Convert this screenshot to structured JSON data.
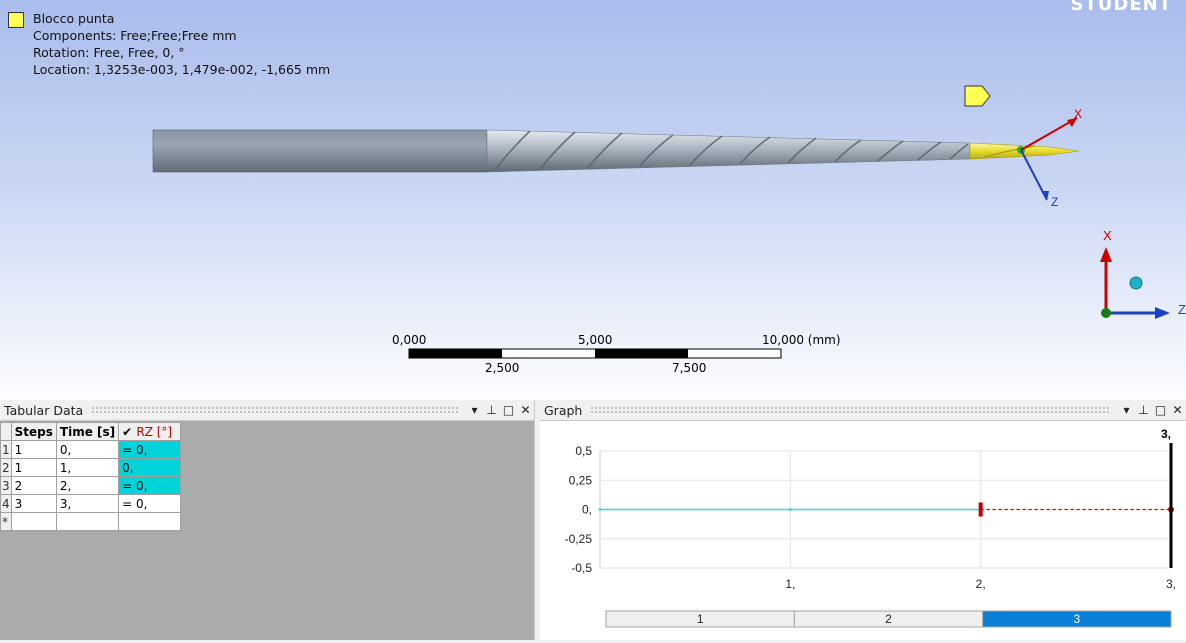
{
  "viewport": {
    "watermark": "STUDENT",
    "annotation": {
      "title": "Blocco punta",
      "components": "Components: Free;Free;Free mm",
      "rotation": "Rotation: Free, Free, 0, °",
      "location": "Location: 1,3253e-003, 1,479e-002, -1,665 mm"
    },
    "local_axes": {
      "x": "X",
      "z": "Z"
    },
    "triad": {
      "x": "X",
      "z": "Z"
    },
    "scale_bar": {
      "top_labels": [
        "0,000",
        "5,000",
        "10,000 (mm)"
      ],
      "bottom_labels": [
        "2,500",
        "7,500"
      ]
    },
    "colors": {
      "highlight": "#ffff55",
      "x_axis": "#cc0000",
      "z_axis": "#1f3fc0",
      "triad_y": "#1a7a1a"
    }
  },
  "tabular": {
    "title": "Tabular Data",
    "columns": [
      "Steps",
      "Time [s]",
      "RZ [°]"
    ],
    "rows": [
      {
        "num": "1",
        "step": "1",
        "time": "0,",
        "rz": "= 0,",
        "highlight": true
      },
      {
        "num": "2",
        "step": "1",
        "time": "1,",
        "rz": "0,",
        "highlight": true
      },
      {
        "num": "3",
        "step": "2",
        "time": "2,",
        "rz": "= 0,",
        "highlight": true
      },
      {
        "num": "4",
        "step": "3",
        "time": "3,",
        "rz": "= 0,",
        "highlight": false
      },
      {
        "num": "*",
        "step": "",
        "time": "",
        "rz": "",
        "highlight": false
      }
    ]
  },
  "graph": {
    "title": "Graph",
    "current_time_label": "3,",
    "step_bar": [
      "1",
      "2",
      "3"
    ],
    "active_step": "3"
  },
  "chart_data": {
    "type": "line",
    "x": [
      0,
      1,
      2,
      3
    ],
    "series": [
      {
        "values": [
          0,
          0,
          0,
          0
        ]
      }
    ],
    "xlim": [
      0,
      3
    ],
    "ylim": [
      -0.5,
      0.5
    ],
    "xticks": [
      "1,",
      "2,",
      "3,"
    ],
    "yticks": [
      "0,5",
      "0,25",
      "0,",
      "-0,25",
      "-0,5"
    ],
    "grid": true,
    "colors": {
      "solid": "#49d0e0",
      "dashed": "#c00000",
      "marker": "#c00000",
      "cursor": "#000000"
    }
  }
}
